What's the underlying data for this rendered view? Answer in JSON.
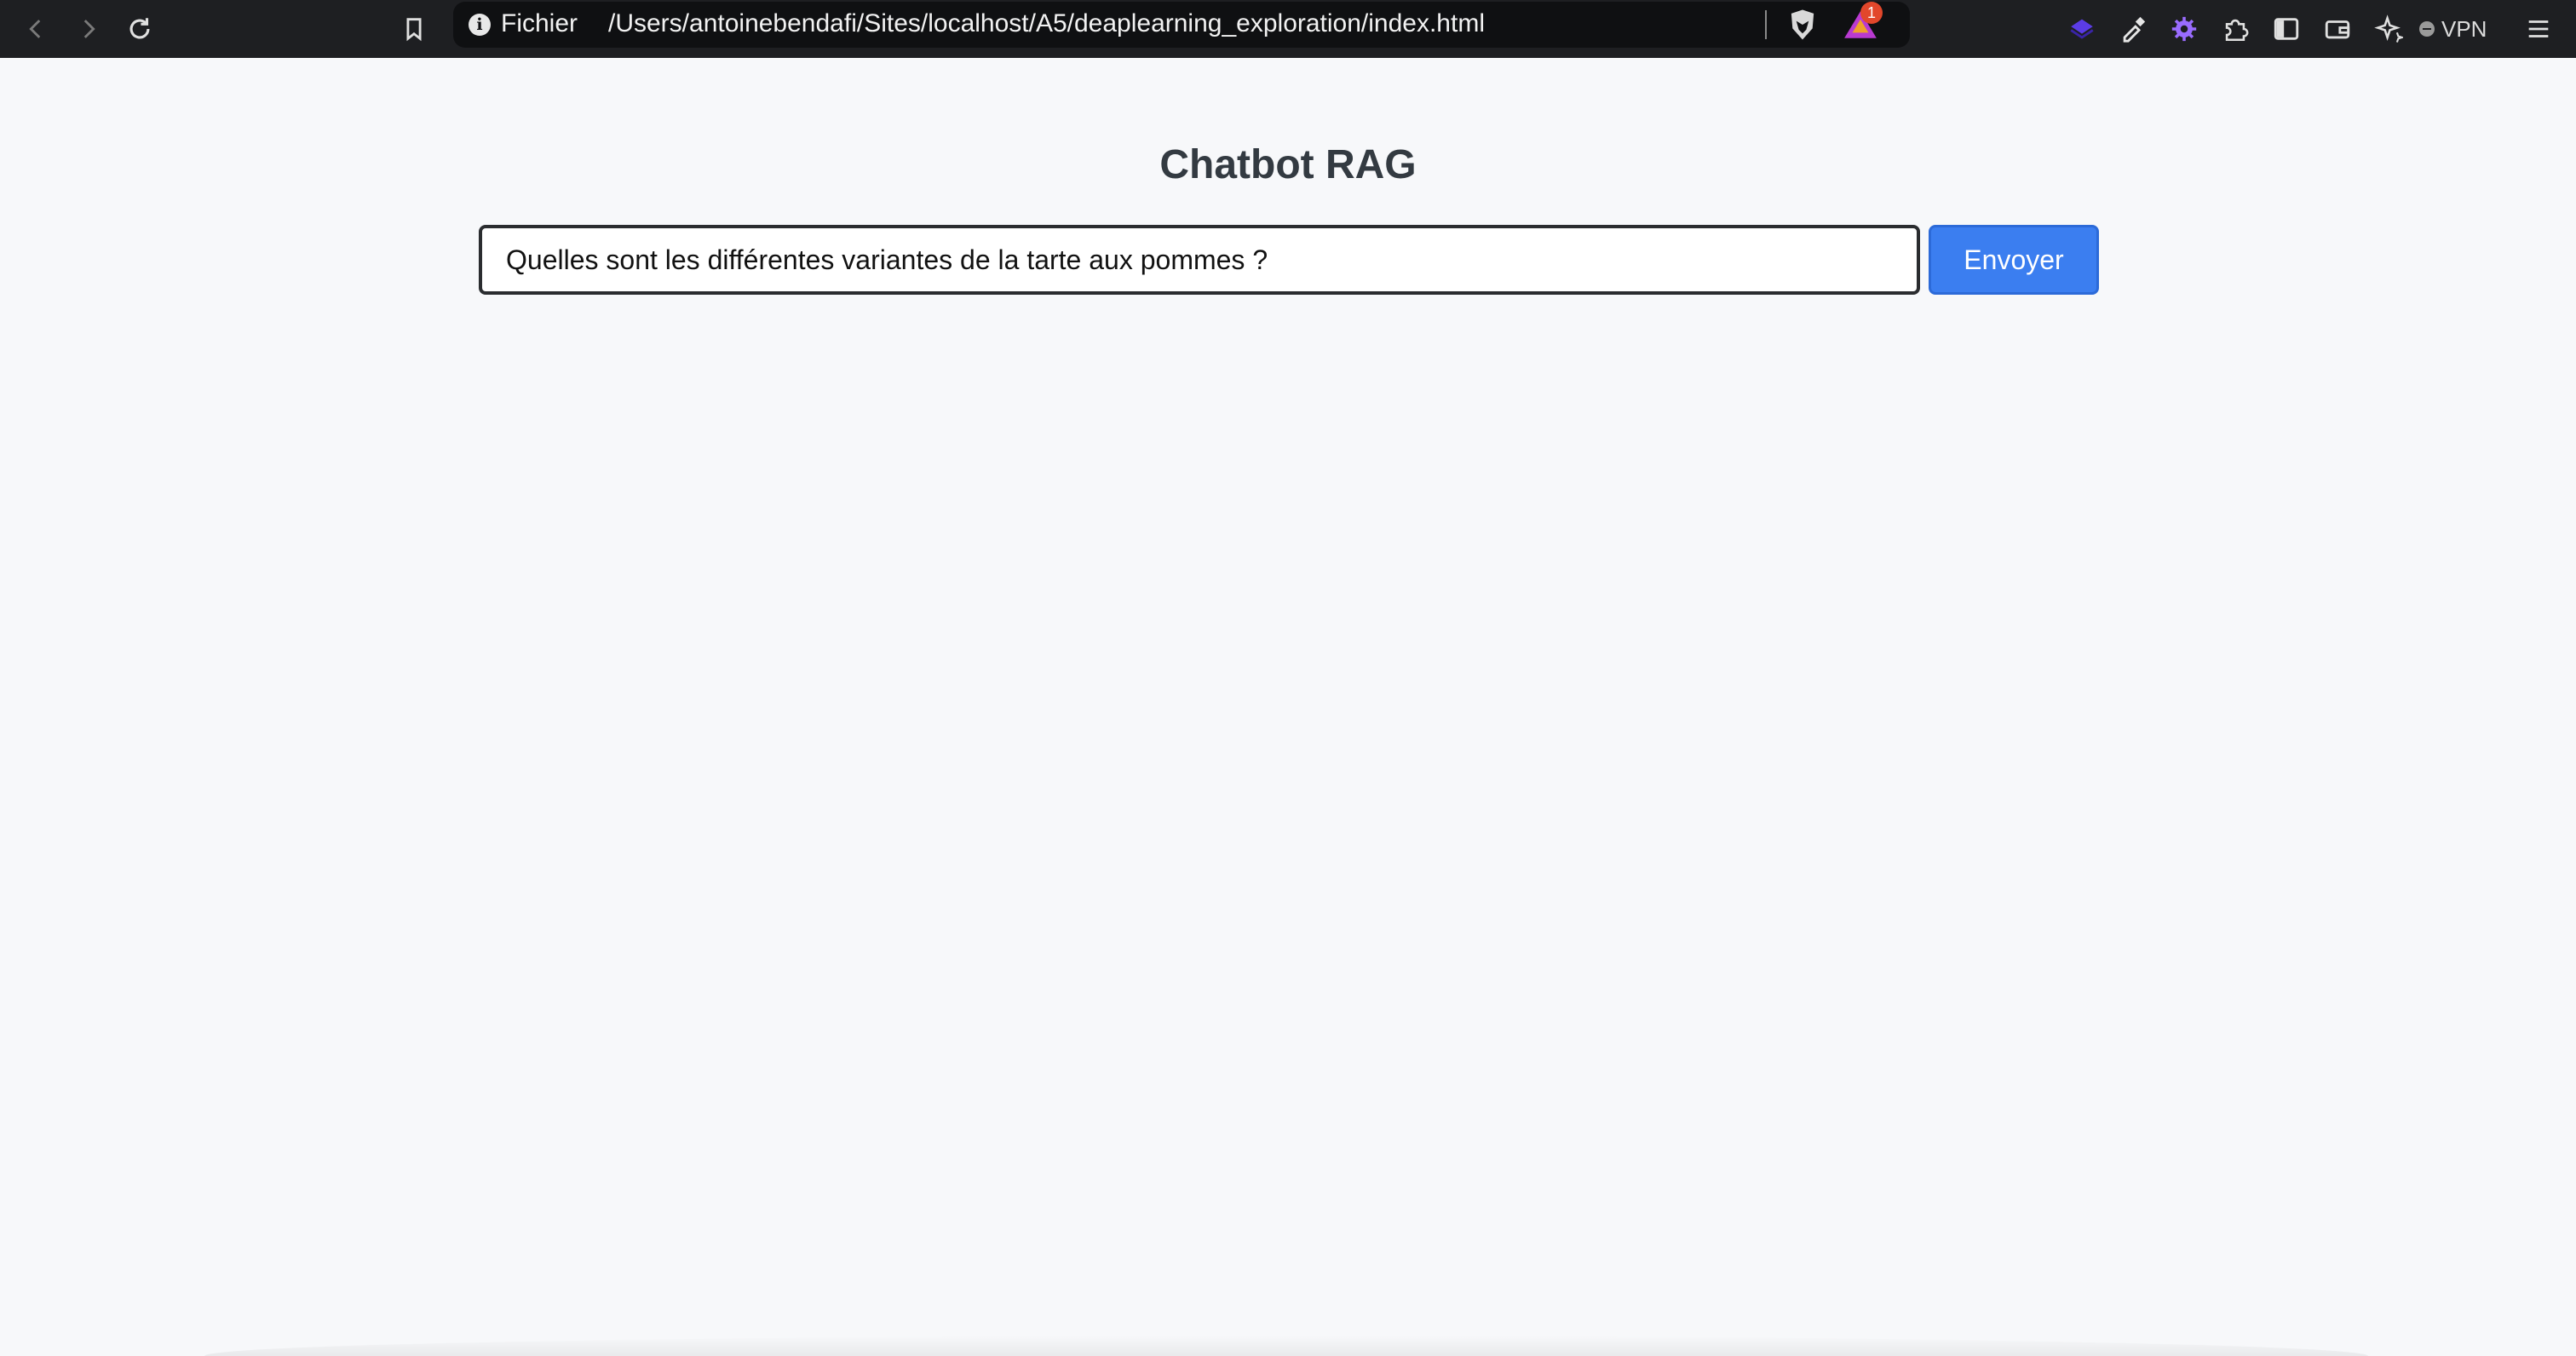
{
  "browser": {
    "address_scheme_label": "Fichier",
    "address_url": "/Users/antoinebendafi/Sites/localhost/A5/deaplearning_exploration/index.html",
    "rewards_badge_count": "1",
    "vpn_label": "VPN",
    "icons": {
      "back": "chevron-left-icon",
      "forward": "chevron-right-icon",
      "reload": "reload-icon",
      "bookmark": "bookmark-icon",
      "site_info": "info-icon",
      "shields": "brave-shield-icon",
      "rewards": "brave-rewards-icon",
      "extension_1": "layers-icon",
      "extension_2": "eyedropper-icon",
      "extension_3": "gear-icon",
      "extensions": "puzzle-icon",
      "sidebar": "sidebar-icon",
      "wallet": "wallet-icon",
      "leo": "sparkle-icon",
      "menu": "hamburger-menu-icon"
    },
    "colors": {
      "toolbar": "#1e1f22",
      "urlbar": "#0f1012",
      "rewards_badge": "#e2472b",
      "extension_purple": "#7b4dff"
    }
  },
  "page": {
    "title": "Chatbot RAG",
    "query_value": "Quelles sont les différentes variantes de la tarte aux pommes ?",
    "send_label": "Envoyer",
    "colors": {
      "background": "#f7f8fa",
      "button": "#3b7ef0",
      "title_text": "#333a41"
    }
  }
}
